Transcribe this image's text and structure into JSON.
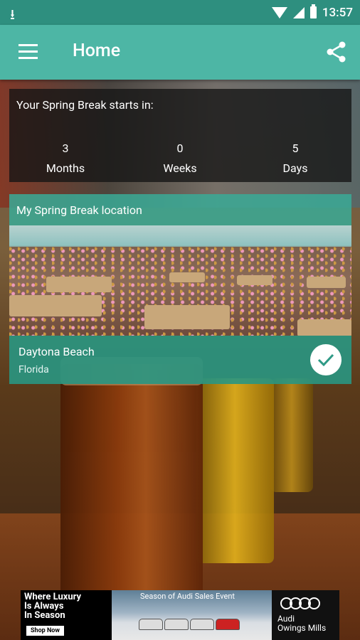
{
  "status_bar": {
    "time": "13:57",
    "download_icon": "download-icon",
    "wifi_icon": "wifi-icon",
    "signal_icon": "signal-icon",
    "battery_icon": "battery-icon"
  },
  "app_bar": {
    "title": "Home",
    "menu_icon": "hamburger-menu-icon",
    "share_icon": "share-icon"
  },
  "countdown": {
    "title": "Your Spring Break starts in:",
    "units": [
      {
        "value": "3",
        "label": "Months"
      },
      {
        "value": "0",
        "label": "Weeks"
      },
      {
        "value": "5",
        "label": "Days"
      }
    ]
  },
  "location": {
    "header": "My Spring Break location",
    "name": "Daytona Beach",
    "state": "Florida",
    "check_icon": "checkmark-icon"
  },
  "ad": {
    "headline": "Where Luxury\nIs Always\nIn Season",
    "cta": "Shop Now",
    "event": "Season of Audi Sales Event",
    "brand": "Audi\nOwings Mills"
  },
  "colors": {
    "status_bar": "#2e8f7f",
    "app_bar": "#4db6a5",
    "location_accent": "#39aa96"
  }
}
